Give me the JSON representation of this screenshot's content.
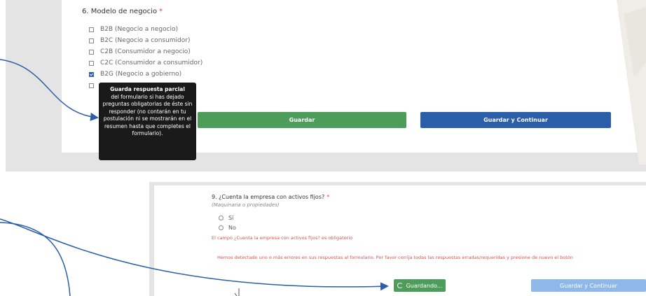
{
  "form_top": {
    "question": "6. Modelo de negocio",
    "required_mark": "*",
    "options": [
      {
        "label": "B2B (Negocio a negocio)",
        "checked": false
      },
      {
        "label": "B2C (Negocio a consumidor)",
        "checked": false
      },
      {
        "label": "C2B (Consumidor a negocio)",
        "checked": false
      },
      {
        "label": "C2C (Consumidor a consumidor)",
        "checked": false
      },
      {
        "label": "B2G (Negocio a gobierno)",
        "checked": true
      }
    ],
    "save_label": "Guardar",
    "save_continue_label": "Guardar y Continuar",
    "tooltip_title": "Guarda respuesta parcial",
    "tooltip_body": "del formulario si has dejado preguntas obligatorias de éste sin responder (no contarán en tu postulación ni se mostrarán en el resumen hasta que completes el formulario)."
  },
  "form_bottom": {
    "question": "9. ¿Cuenta la empresa con activos fijos?",
    "required_mark": "*",
    "hint": "(Maquinaria o propiedades)",
    "options": [
      "Sí",
      "No"
    ],
    "field_error": "El campo ¿Cuenta la empresa con activos fijos? es obligatorio",
    "form_error": "Hemos detectado uno o más errores en sus respuestas al formulario. Por favor corrija todas las respuestas erradas/requeridas y presione de nuevo el botón",
    "saving_label": "Guardando...",
    "save_continue_label": "Guardar y Continuar"
  },
  "colors": {
    "green": "#4e9c5a",
    "blue": "#2a5ea8",
    "blue_disabled": "#8fb8ea",
    "error": "#d9534f",
    "arrow": "#2a5ea8"
  }
}
